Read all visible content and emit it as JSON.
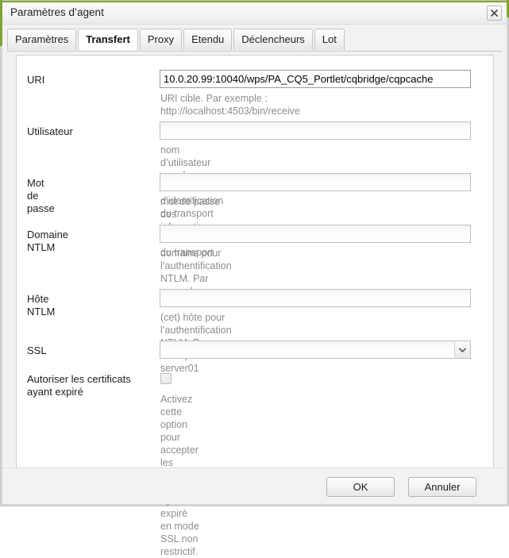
{
  "window": {
    "title": "Paramètres d’agent",
    "close_icon": "close-icon",
    "accent_color": "#7ea52f"
  },
  "tabs": [
    {
      "label": "Paramètres",
      "active": false
    },
    {
      "label": "Transfert",
      "active": true
    },
    {
      "label": "Proxy",
      "active": false
    },
    {
      "label": "Etendu",
      "active": false
    },
    {
      "label": "Déclencheurs",
      "active": false
    },
    {
      "label": "Lot",
      "active": false
    }
  ],
  "form": {
    "uri": {
      "label": "URI",
      "value": "10.0.20.99:10040/wps/PA_CQ5_Portlet/cqbridge/cqpcache",
      "hint": "URI cible. Par exemple : http://localhost:4503/bin/receive"
    },
    "user": {
      "label": "Utilisateur",
      "value": "",
      "hint": "nom d’utilisateur pour les informations d’identification du transport"
    },
    "password": {
      "label": "Mot de passe",
      "value": "",
      "hint": "mot de passe des informations d’identification du transport"
    },
    "ntlm_domain": {
      "label": "Domaine NTLM",
      "value": "",
      "hint": "domaine pour l’authentification NTLM. Par exemple :\nWORKGROUP"
    },
    "ntlm_host": {
      "label": "Hôte NTLM",
      "value": "",
      "hint": "(cet) hôte pour l’authentification NTLM. Par exemple : server01"
    },
    "ssl": {
      "label": "SSL",
      "value": "",
      "dropdown_icon": "chevron-down-icon"
    },
    "allow_expired": {
      "label": "Autoriser les certificats\nayant expiré",
      "checked": false,
      "hint": "Activez cette option pour accepter les certificats SSL ayant expiré\nen mode SSL non restrictif."
    }
  },
  "footer": {
    "ok_label": "OK",
    "cancel_label": "Annuler"
  }
}
